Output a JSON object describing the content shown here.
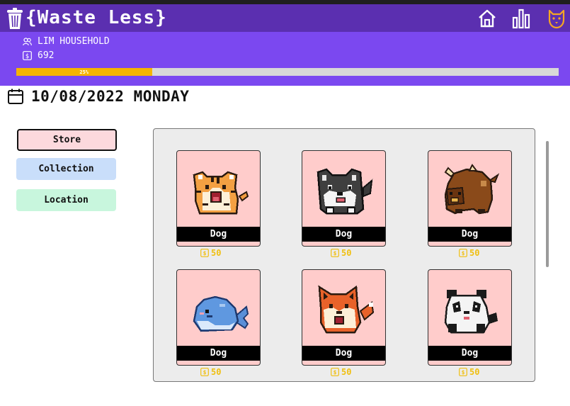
{
  "app": {
    "title": "{Waste Less}"
  },
  "nav": {
    "home_icon": "home-icon",
    "stats_icon": "bar-chart-icon",
    "profile_icon": "dog-face-icon"
  },
  "household": {
    "name": "LIM HOUSEHOLD",
    "coins": "692"
  },
  "progress": {
    "value": 0.25,
    "label": "25%"
  },
  "date": {
    "text": "10/08/2022 MONDAY"
  },
  "sidebar": {
    "items": [
      {
        "label": "Store",
        "active": true
      },
      {
        "label": "Collection"
      },
      {
        "label": "Location"
      }
    ]
  },
  "store": {
    "items": [
      {
        "animal": "tiger",
        "label": "Dog",
        "price": "50"
      },
      {
        "animal": "husky",
        "label": "Dog",
        "price": "50"
      },
      {
        "animal": "bison",
        "label": "Dog",
        "price": "50"
      },
      {
        "animal": "whale",
        "label": "Dog",
        "price": "50"
      },
      {
        "animal": "fox",
        "label": "Dog",
        "price": "50"
      },
      {
        "animal": "panda",
        "label": "Dog",
        "price": "50"
      }
    ]
  },
  "colors": {
    "titlebar": "#5b2fb0",
    "header": "#7b48f0",
    "progress_fill": "#f5b400",
    "card_bg": "#ffcccb",
    "price": "#f0bf10"
  }
}
